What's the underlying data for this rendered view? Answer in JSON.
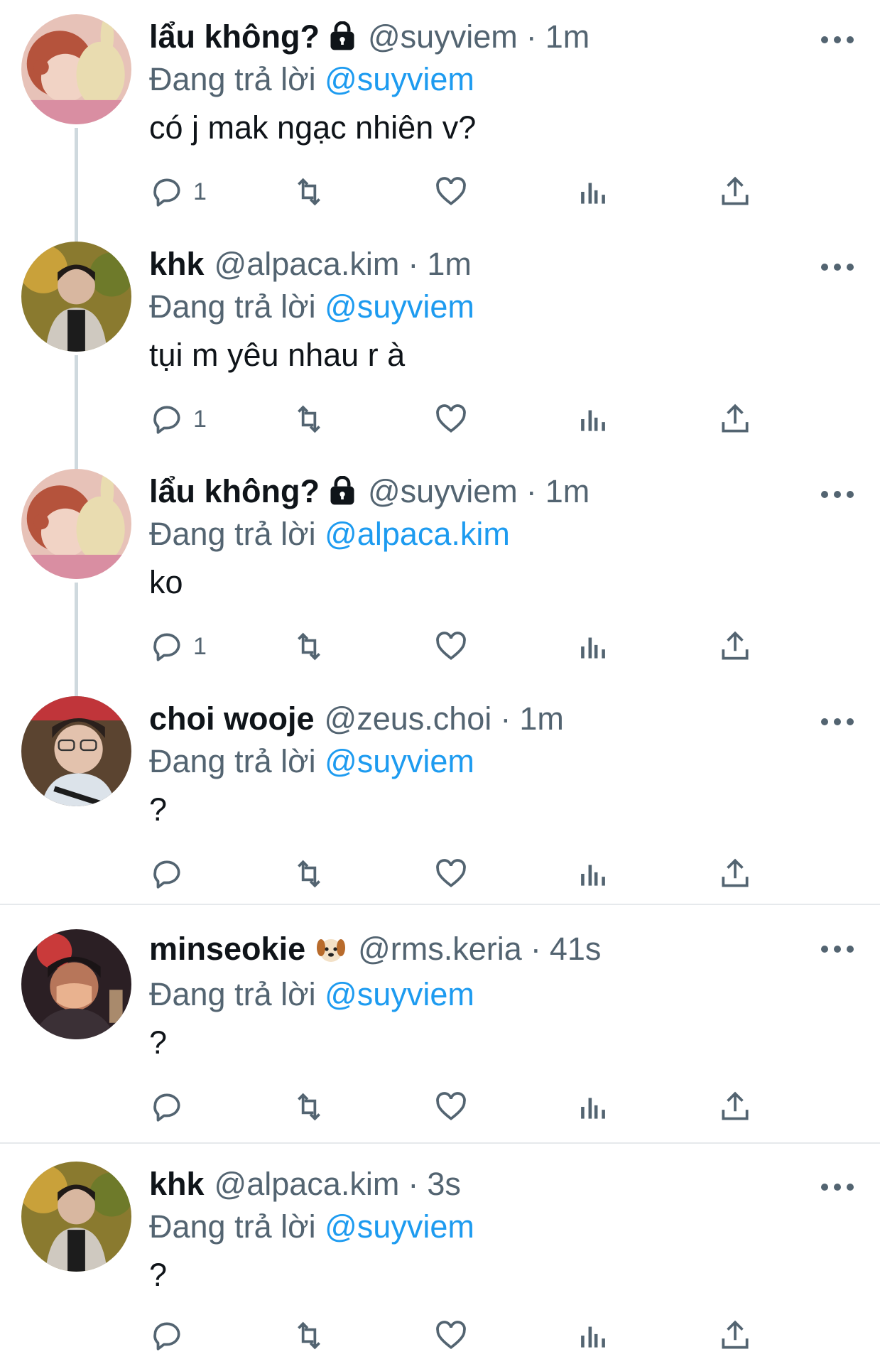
{
  "tweets": [
    {
      "name": "lẩu không?",
      "badge": "lock-icon",
      "handle": "@suyviem",
      "sep": "·",
      "time": "1m",
      "replying_prefix": "Đang trả lời",
      "replying_to": "@suyviem",
      "text": "có j mak ngạc nhiên v?",
      "reply_count": "1",
      "avatar": "cartoon-avatar"
    },
    {
      "name": "khk",
      "badge": "",
      "handle": "@alpaca.kim",
      "sep": "·",
      "time": "1m",
      "replying_prefix": "Đang trả lời",
      "replying_to": "@suyviem",
      "text": "tụi m yêu nhau r à",
      "reply_count": "1",
      "avatar": "photo-avatar"
    },
    {
      "name": "lẩu không?",
      "badge": "lock-icon",
      "handle": "@suyviem",
      "sep": "·",
      "time": "1m",
      "replying_prefix": "Đang trả lời",
      "replying_to": "@alpaca.kim",
      "text": "ko",
      "reply_count": "1",
      "avatar": "cartoon-avatar"
    },
    {
      "name": "choi wooje",
      "badge": "",
      "handle": "@zeus.choi",
      "sep": "·",
      "time": "1m",
      "replying_prefix": "Đang trả lời",
      "replying_to": "@suyviem",
      "text": "?",
      "reply_count": "",
      "avatar": "photo-avatar"
    },
    {
      "name": "minseokie",
      "badge": "dog-emoji-icon",
      "handle": "@rms.keria",
      "sep": "·",
      "time": "41s",
      "replying_prefix": "Đang trả lời",
      "replying_to": "@suyviem",
      "text": "?",
      "reply_count": "",
      "avatar": "photo-avatar"
    },
    {
      "name": "khk",
      "badge": "",
      "handle": "@alpaca.kim",
      "sep": "·",
      "time": "3s",
      "replying_prefix": "Đang trả lời",
      "replying_to": "@suyviem",
      "text": "?",
      "reply_count": "",
      "avatar": "photo-avatar"
    }
  ],
  "action_icons": [
    "reply-icon",
    "retweet-icon",
    "like-icon",
    "views-icon",
    "share-icon"
  ],
  "colors": {
    "accent": "#1d9bf0",
    "secondary_text": "#536471",
    "primary_text": "#0f1419",
    "thread_line": "#cfd9de"
  }
}
